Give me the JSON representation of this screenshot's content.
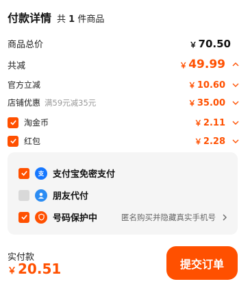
{
  "header": {
    "title": "付款详情",
    "count_prefix": "共",
    "count": "1",
    "count_suffix": "件商品"
  },
  "rows": {
    "total": {
      "label": "商品总价",
      "currency": "￥",
      "amount": "70.50"
    },
    "discount": {
      "label": "共减",
      "currency": "￥",
      "amount": "49.99"
    },
    "official": {
      "label": "官方立减",
      "currency": "￥",
      "amount": "10.60"
    },
    "store": {
      "label": "店铺优惠",
      "sub": "满59元减35元",
      "currency": "￥",
      "amount": "35.00"
    },
    "taojinbi": {
      "label": "淘金币",
      "currency": "￥",
      "amount": "2.11",
      "checked": true
    },
    "hongbao": {
      "label": "红包",
      "currency": "￥",
      "amount": "2.28",
      "checked": true
    }
  },
  "options": {
    "alipay": {
      "label": "支付宝免密支付",
      "checked": true,
      "icon": "alipay-icon"
    },
    "friend": {
      "label": "朋友代付",
      "checked": false,
      "icon": "friend-pay-icon"
    },
    "privacy": {
      "label": "号码保护中",
      "checked": true,
      "icon": "shield-icon",
      "hint": "匿名购买并隐藏真实手机号"
    }
  },
  "footer": {
    "label": "实付款",
    "currency": "￥",
    "amount": "20.51",
    "submit_label": "提交订单"
  },
  "colors": {
    "accent": "#ff5000",
    "alipay_blue": "#1677ff",
    "friend_blue": "#2b8cf3"
  }
}
